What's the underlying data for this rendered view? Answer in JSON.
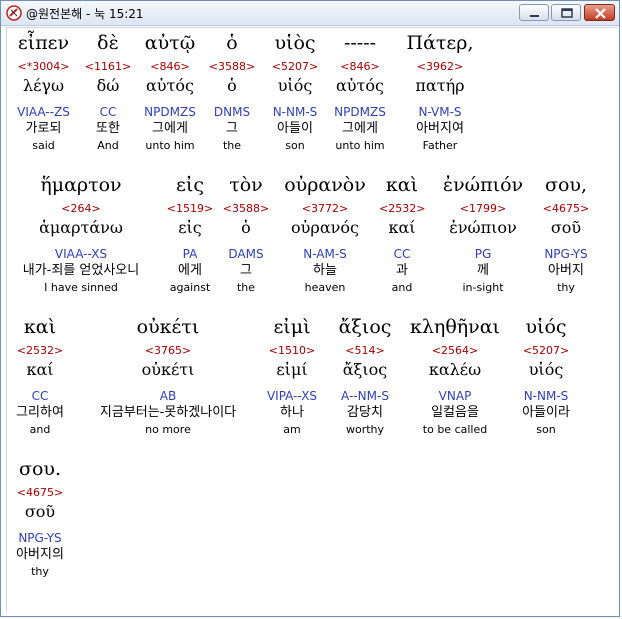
{
  "window": {
    "title": "@원전본해 - 눅 15:21"
  },
  "lines": [
    [
      {
        "greek": "εἶπεν",
        "strong": "<*3004>",
        "lexeme": "λέγω",
        "parse": "VIAA--ZS",
        "korean": "가로되",
        "english": "said"
      },
      {
        "greek": "δὲ",
        "strong": "<1161>",
        "lexeme": "δώ",
        "parse": "CC",
        "korean": "또한",
        "english": "And"
      },
      {
        "greek": "αὐτῷ",
        "strong": "<846>",
        "lexeme": "αὐτός",
        "parse": "NPDMZS",
        "korean": "그에게",
        "english": "unto him"
      },
      {
        "greek": "ὁ",
        "strong": "<3588>",
        "lexeme": "ὁ",
        "parse": "DNMS",
        "korean": "그",
        "english": "the"
      },
      {
        "greek": "υἱὸς",
        "strong": "<5207>",
        "lexeme": "υἱός",
        "parse": "N-NM-S",
        "korean": "아들이",
        "english": "son"
      },
      {
        "greek": "-----",
        "strong": "<846>",
        "lexeme": "αὐτός",
        "parse": "NPDMZS",
        "korean": "그에게",
        "english": "unto him"
      },
      {
        "greek": "Πάτερ,",
        "strong": "<3962>",
        "lexeme": "πατήρ",
        "parse": "N-VM-S",
        "korean": "아버지여",
        "english": "Father"
      }
    ],
    [
      {
        "greek": "ἥμαρτον",
        "strong": "<264>",
        "lexeme": "ἁμαρτάνω",
        "parse": "VIAA--XS",
        "korean": "내가-죄를 얻었사오니",
        "english": "I have sinned"
      },
      {
        "greek": "εἰς",
        "strong": "<1519>",
        "lexeme": "εἰς",
        "parse": "PA",
        "korean": "에게",
        "english": "against"
      },
      {
        "greek": "τὸν",
        "strong": "<3588>",
        "lexeme": "ὁ",
        "parse": "DAMS",
        "korean": "그",
        "english": "the"
      },
      {
        "greek": "οὐρανὸν",
        "strong": "<3772>",
        "lexeme": "οὐρανός",
        "parse": "N-AM-S",
        "korean": "하늘",
        "english": "heaven"
      },
      {
        "greek": "καὶ",
        "strong": "<2532>",
        "lexeme": "καί",
        "parse": "CC",
        "korean": "과",
        "english": "and"
      },
      {
        "greek": "ἐνώπιόν",
        "strong": "<1799>",
        "lexeme": "ἐνώπιον",
        "parse": "PG",
        "korean": "께",
        "english": "in-sight"
      },
      {
        "greek": "σου,",
        "strong": "<4675>",
        "lexeme": "σοῦ",
        "parse": "NPG-YS",
        "korean": "아버지",
        "english": "thy"
      }
    ],
    [
      {
        "greek": "καὶ",
        "strong": "<2532>",
        "lexeme": "καί",
        "parse": "CC",
        "korean": "그리하여",
        "english": "and"
      },
      {
        "greek": "οὐκέτι",
        "strong": "<3765>",
        "lexeme": "οὐκέτι",
        "parse": "AB",
        "korean": "지금부터는-못하겠나이다",
        "english": "no more"
      },
      {
        "greek": "εἰμὶ",
        "strong": "<1510>",
        "lexeme": "εἰμί",
        "parse": "VIPA--XS",
        "korean": "하나",
        "english": "am"
      },
      {
        "greek": "ἄξιος",
        "strong": "<514>",
        "lexeme": "ἄξιος",
        "parse": "A--NM-S",
        "korean": "감당치",
        "english": "worthy"
      },
      {
        "greek": "κληθῆναι",
        "strong": "<2564>",
        "lexeme": "καλέω",
        "parse": "VNAP",
        "korean": "일컬음을",
        "english": "to be called"
      },
      {
        "greek": "υἱός",
        "strong": "<5207>",
        "lexeme": "υἱός",
        "parse": "N-NM-S",
        "korean": "아들이라",
        "english": "son"
      }
    ],
    [
      {
        "greek": "σου.",
        "strong": "<4675>",
        "lexeme": "σοῦ",
        "parse": "NPG-YS",
        "korean": "아버지의",
        "english": "thy"
      }
    ]
  ],
  "colors": {
    "strong": "#a40000",
    "parse": "#2f3fb5",
    "selected_background": "#ffffff"
  },
  "icons": {
    "app": "app-logo-icon",
    "minimize": "minimize-icon",
    "maximize": "maximize-icon",
    "close": "close-icon"
  }
}
